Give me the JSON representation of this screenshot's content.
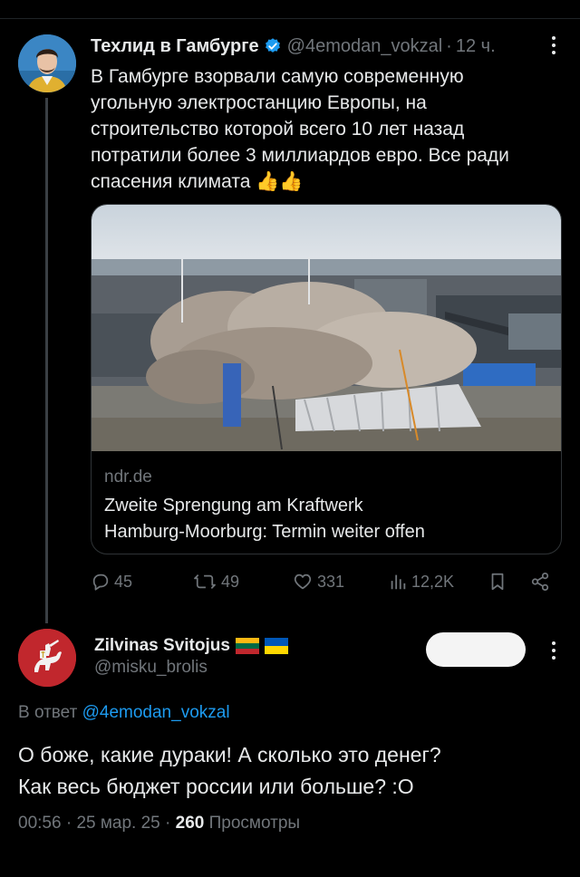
{
  "tweet": {
    "author_name": "Техлид в Гамбурге",
    "handle": "@4emodan_vokzal",
    "separator": "·",
    "time": "12 ч.",
    "text_lines": [
      "В Гамбурге взорвали самую современную",
      "угольную электростанцию Европы, на",
      "строительство которой всего 10 лет назад",
      "потратили более 3 миллиардов евро. Все ради",
      "спасения климата 👍👍"
    ],
    "card": {
      "domain": "ndr.de",
      "title_lines": [
        "Zweite Sprengung am Kraftwerk",
        "Hamburg-Moorburg: Termin weiter offen"
      ]
    },
    "actions": {
      "replies": "45",
      "retweets": "49",
      "likes": "331",
      "views": "12,2K"
    },
    "icons": {
      "verified": "verified-badge-icon",
      "reply": "reply-icon",
      "retweet": "retweet-icon",
      "like": "heart-icon",
      "views": "views-bar-chart-icon",
      "bookmark": "bookmark-icon",
      "share": "share-icon",
      "more": "more-vertical-icon"
    },
    "colors": {
      "verified": "#1d9bf0"
    }
  },
  "reply": {
    "author_name": "Zilvinas Svitojus",
    "handle": "@misku_brolis",
    "reply_prefix": "В ответ",
    "reply_mention": "@4emodan_vokzal",
    "text_lines": [
      "О боже, какие дураки! А сколько это денег?",
      "Как весь бюджет россии или больше? :О"
    ],
    "time": "00:56",
    "date": "25 мар. 25",
    "views_count": "260",
    "views_label": "Просмотры",
    "separator": "·",
    "flags": [
      "lithuania-flag-icon",
      "ukraine-flag-icon"
    ],
    "colors": {
      "mention": "#1d9bf0",
      "avatar_bg": "#c1272d"
    }
  }
}
